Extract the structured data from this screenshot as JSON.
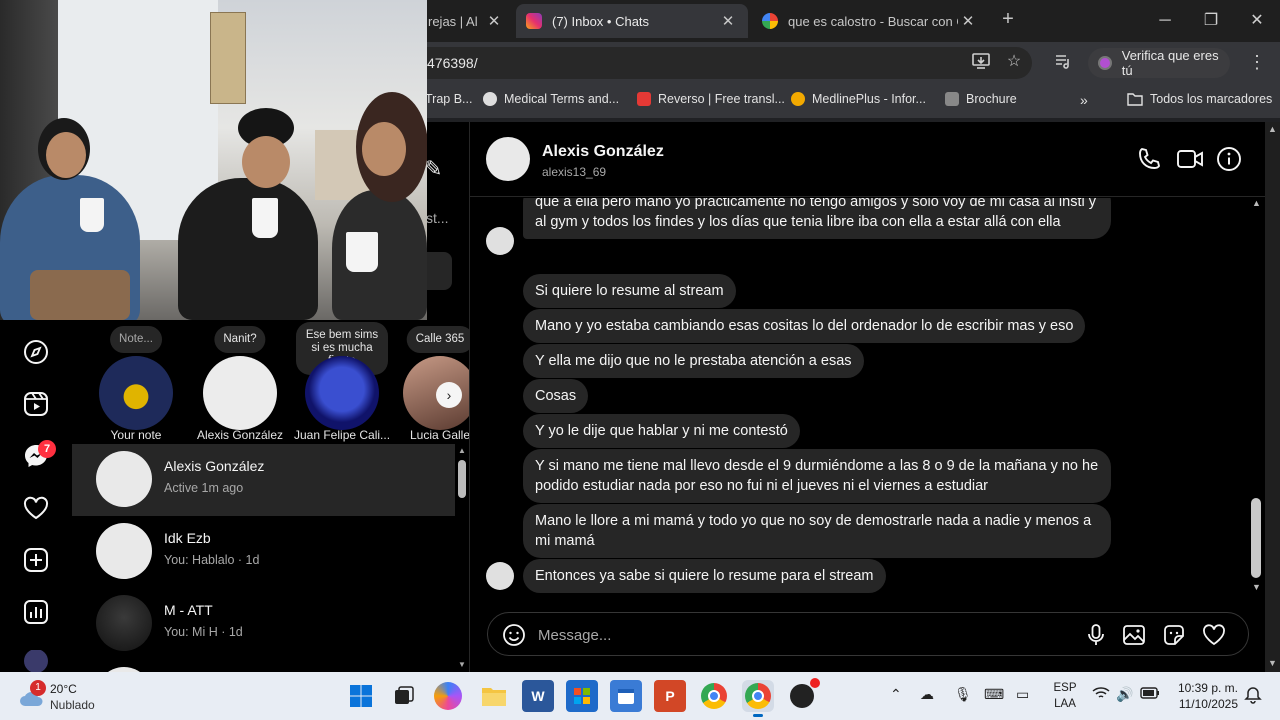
{
  "browser": {
    "tabs": [
      {
        "title": "rejas | Al",
        "active": false
      },
      {
        "title": "(7) Inbox • Chats",
        "active": true
      },
      {
        "title": "que es calostro - Buscar con Go",
        "active": false
      }
    ],
    "url_fragment": "476398/",
    "verify_label": "Verifica que eres tú",
    "bookmarks": [
      "Trap B...",
      "Medical Terms and...",
      "Reverso | Free transl...",
      "MedlinePlus - Infor...",
      "Brochure"
    ],
    "all_bookmarks": "Todos los marcadores"
  },
  "sidebar": {
    "upper_text": "st...",
    "messages_badge": "7",
    "icons": [
      "explore-icon",
      "reels-icon",
      "messenger-icon",
      "heart-icon",
      "create-icon",
      "dashboard-icon"
    ]
  },
  "notes": [
    {
      "bubble": "Note...",
      "name": "Your note"
    },
    {
      "bubble": "Nanit?",
      "name": "Alexis González"
    },
    {
      "bubble": "Ese bem sims si es mucha fiesta",
      "name": "Juan Felipe Cali..."
    },
    {
      "bubble": "Calle 365",
      "name": "Lucia Galle"
    }
  ],
  "conversations": [
    {
      "name": "Alexis González",
      "sub": "Active 1m ago",
      "active": true
    },
    {
      "name": "Idk Ezb",
      "sub": "You: Hablalo · 1d",
      "active": false
    },
    {
      "name": "M - ATT",
      "sub": "You: Mi H · 1d",
      "active": false
    }
  ],
  "chat": {
    "name": "Alexis González",
    "username": "alexis13_69",
    "messages": [
      "que a ella pero mano yo prácticamente no tengo amigos y solo voy de mi casa al insti y al gym y todos los findes y los días que tenia libre iba con ella a estar allá con ella",
      "Si quiere lo resume al stream",
      "Mano y yo estaba cambiando esas cositas lo del ordenador lo de escribir mas y eso",
      "Y ella me dijo que no le prestaba atención a esas",
      "Cosas",
      "Y yo le dije que hablar y ni me contestó",
      "Y si mano me tiene mal llevo desde el 9 durmiéndome a las 8 o 9 de la mañana y no he podido estudiar nada por eso no fui ni el jueves ni el viernes a estudiar",
      "Mano le llore a mi mamá y todo yo que no soy de demostrarle nada a nadie y menos a mi mamá",
      "Entonces ya sabe si quiere lo resume para el stream"
    ],
    "composer_placeholder": "Message..."
  },
  "taskbar": {
    "weather_temp": "20°C",
    "weather_cond": "Nublado",
    "weather_badge": "1",
    "lang_line1": "ESP",
    "lang_line2": "LAA",
    "time": "10:39 p. m.",
    "date": "11/10/2025"
  },
  "colors": {
    "chrome_bg": "#202124",
    "ig_bg": "#000000",
    "bubble_bg": "#262626",
    "badge_red": "#ff3040",
    "taskbar_bg": "#e8edf4"
  }
}
